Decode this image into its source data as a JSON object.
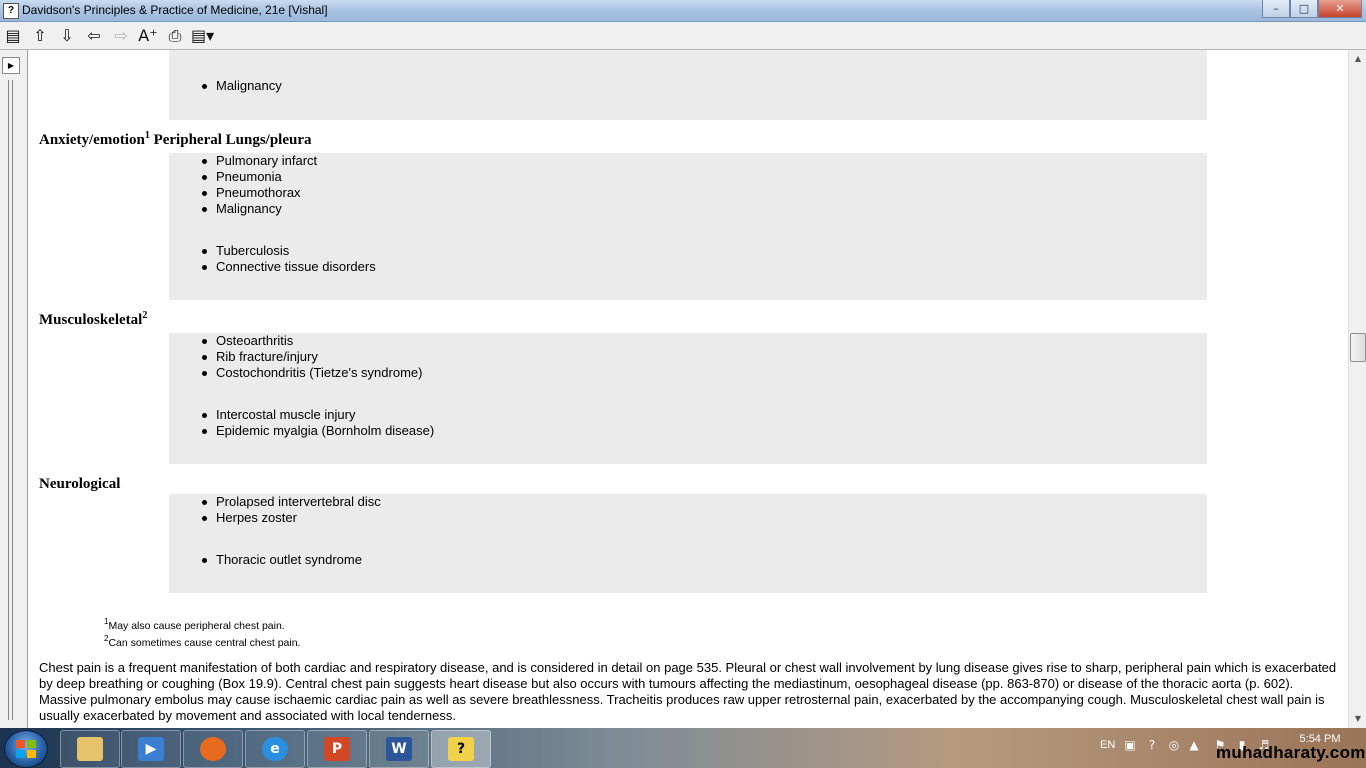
{
  "window": {
    "title": "Davidson's Principles & Practice of Medicine, 21e [Vishal]",
    "minimize": "–",
    "maximize": "□",
    "close": "✕"
  },
  "toolbar": {
    "icons": [
      "hide-pane-icon",
      "arrow-up-icon",
      "arrow-down-icon",
      "back-icon",
      "forward-icon",
      "font-size-icon",
      "print-icon",
      "options-icon"
    ]
  },
  "sections": [
    {
      "heading": "",
      "items": [
        "Malignancy"
      ]
    },
    {
      "heading": "Anxiety/emotion",
      "heading_sup": "1",
      "heading_suffix": " Peripheral Lungs/pleura",
      "items": [
        "Pulmonary infarct",
        "Pneumonia",
        "Pneumothorax",
        "Malignancy",
        "Tuberculosis",
        "Connective tissue disorders"
      ]
    },
    {
      "heading": "Musculoskeletal",
      "heading_sup": "2",
      "items": [
        "Osteoarthritis",
        "Rib fracture/injury",
        "Costochondritis (Tietze's syndrome)",
        "Intercostal muscle injury",
        "Epidemic myalgia (Bornholm disease)"
      ]
    },
    {
      "heading": "Neurological",
      "items": [
        "Prolapsed intervertebral disc",
        "Herpes zoster",
        "Thoracic outlet syndrome"
      ]
    }
  ],
  "footnotes": [
    {
      "mark": "1",
      "text": "May also cause peripheral chest pain."
    },
    {
      "mark": "2",
      "text": "Can sometimes cause central chest pain."
    }
  ],
  "paragraph": "Chest pain is a frequent manifestation of both cardiac and respiratory disease, and is considered in detail on page 535. Pleural or chest wall involvement by lung disease gives rise to sharp, peripheral pain which is exacerbated by deep breathing or coughing (Box 19.9). Central chest pain suggests heart disease but also occurs with tumours affecting the mediastinum, oesophageal disease (pp. 863-870) or disease of the thoracic aorta (p. 602). Massive pulmonary embolus may cause ischaemic cardiac pain as well as severe breathlessness. Tracheitis produces raw upper retrosternal pain, exacerbated by the accompanying cough. Musculoskeletal chest wall pain is usually exacerbated by movement and associated with local tenderness.",
  "taskbar": {
    "apps": [
      "Windows Explorer",
      "Windows Media Player",
      "Firefox",
      "Internet Explorer",
      "PowerPoint",
      "Word",
      "HTML Help"
    ],
    "language": "EN",
    "time": "5:54 PM",
    "watermark": "muhadharaty.com"
  }
}
